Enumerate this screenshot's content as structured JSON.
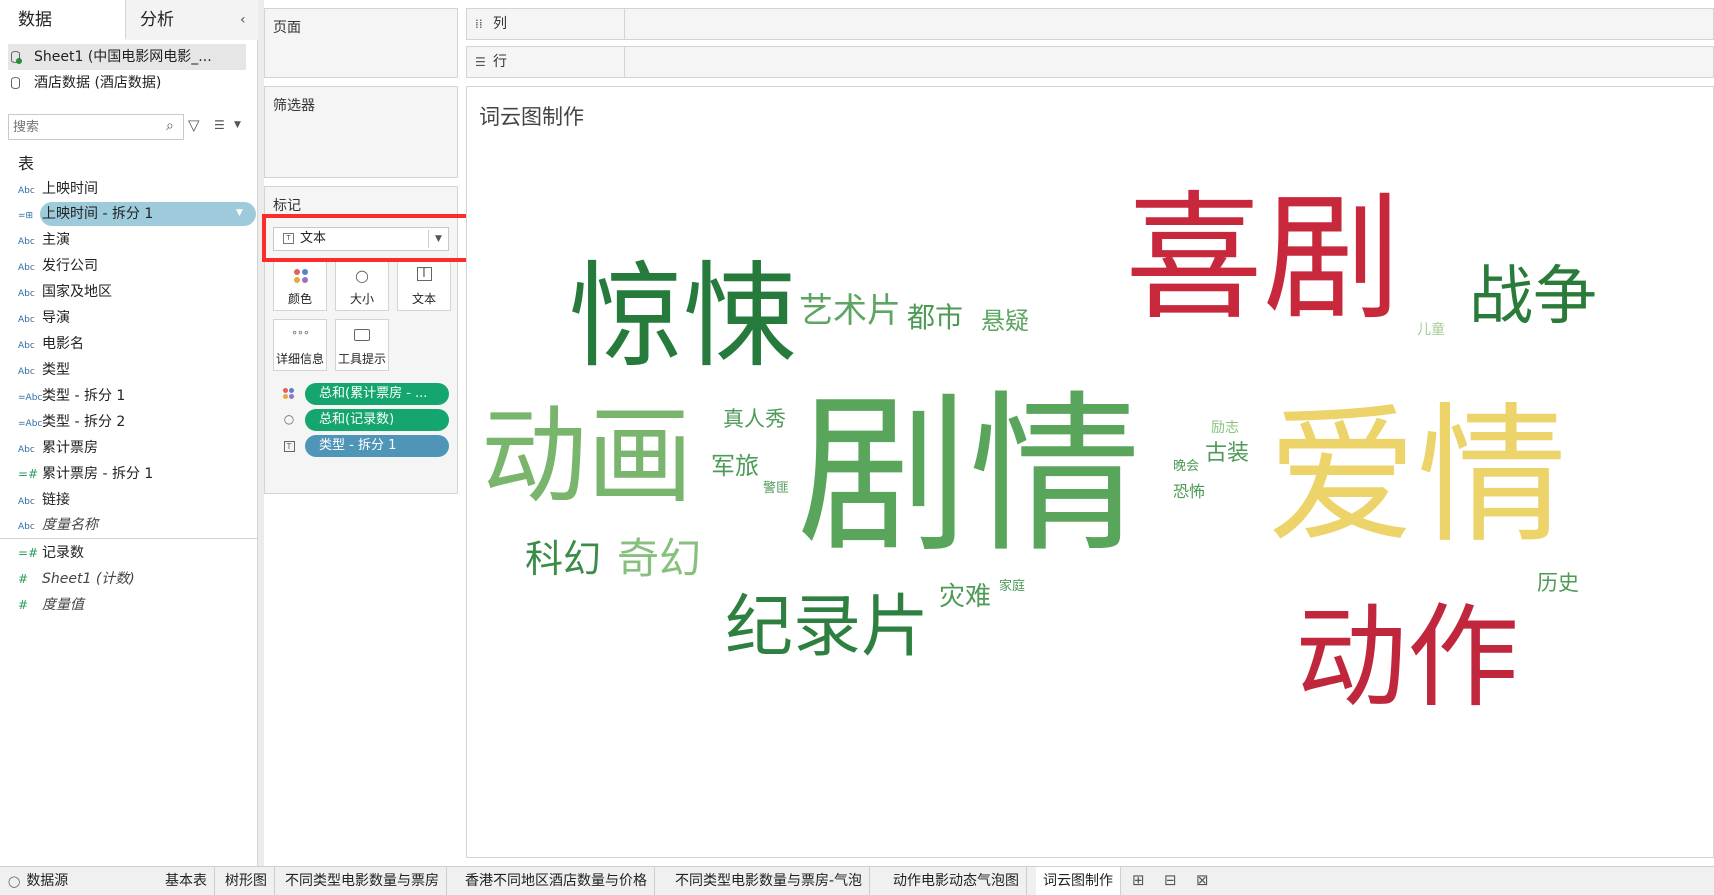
{
  "data_pane": {
    "tab_data": "数据",
    "tab_analysis": "分析",
    "collapse_icon": "chevron-left-icon",
    "sources": [
      {
        "label": "Sheet1 (中国电影网电影_..."
      },
      {
        "label": "酒店数据 (酒店数据)"
      }
    ],
    "search_placeholder": "搜索",
    "table_heading": "表",
    "fields": [
      {
        "type": "Abc",
        "label": "上映时间"
      },
      {
        "type": "=⊞",
        "label": "上映时间 - 拆分 1"
      },
      {
        "type": "Abc",
        "label": "主演"
      },
      {
        "type": "Abc",
        "label": "发行公司"
      },
      {
        "type": "Abc",
        "label": "国家及地区"
      },
      {
        "type": "Abc",
        "label": "导演"
      },
      {
        "type": "Abc",
        "label": "电影名"
      },
      {
        "type": "Abc",
        "label": "类型"
      },
      {
        "type": "=Abc",
        "label": "类型 - 拆分 1"
      },
      {
        "type": "=Abc",
        "label": "类型 - 拆分 2"
      },
      {
        "type": "Abc",
        "label": "累计票房"
      },
      {
        "type": "=#",
        "label": "累计票房 - 拆分 1"
      },
      {
        "type": "Abc",
        "label": "链接"
      },
      {
        "type": "Abc",
        "label": "度量名称"
      }
    ],
    "measures": [
      {
        "type": "=#",
        "label": "记录数"
      },
      {
        "type": "#",
        "label": "Sheet1 (计数)"
      },
      {
        "type": "#",
        "label": "度量值"
      }
    ]
  },
  "cards": {
    "pages_title": "页面",
    "filters_title": "筛选器",
    "marks_title": "标记",
    "mark_type": "文本",
    "mark_buttons": {
      "color": "颜色",
      "size": "大小",
      "text": "文本",
      "detail": "详细信息",
      "tooltip": "工具提示"
    },
    "pills": {
      "color": "总和(累计票房 - ...",
      "size": "总和(记录数)",
      "text": "类型 - 拆分 1"
    }
  },
  "shelves": {
    "columns": "列",
    "rows": "行"
  },
  "view": {
    "title": "词云图制作",
    "words": [
      {
        "text": "剧情",
        "size": 172,
        "color": "#5aa55c"
      },
      {
        "text": "爱情",
        "size": 150,
        "color": "#edd46a"
      },
      {
        "text": "喜剧",
        "size": 138,
        "color": "#c8283c"
      },
      {
        "text": "惊悚",
        "size": 114,
        "color": "#257a3c"
      },
      {
        "text": "动画",
        "size": 106,
        "color": "#79b56c"
      },
      {
        "text": "动作",
        "size": 112,
        "color": "#c0263c"
      },
      {
        "text": "纪录片",
        "size": 68,
        "color": "#2e8040"
      },
      {
        "text": "战争",
        "size": 64,
        "color": "#2a7a3a"
      },
      {
        "text": "艺术片",
        "size": 34,
        "color": "#5da562"
      },
      {
        "text": "都市",
        "size": 28,
        "color": "#4c9a54"
      },
      {
        "text": "悬疑",
        "size": 24,
        "color": "#5da562"
      },
      {
        "text": "科幻",
        "size": 38,
        "color": "#3b8c48"
      },
      {
        "text": "奇幻",
        "size": 42,
        "color": "#86c07c"
      },
      {
        "text": "真人秀",
        "size": 21,
        "color": "#4e9a57"
      },
      {
        "text": "军旅",
        "size": 24,
        "color": "#4e9a57"
      },
      {
        "text": "警匪",
        "size": 13,
        "color": "#4e9a57"
      },
      {
        "text": "灾难",
        "size": 26,
        "color": "#4e9a57"
      },
      {
        "text": "家庭",
        "size": 13,
        "color": "#4e9a57"
      },
      {
        "text": "古装",
        "size": 22,
        "color": "#4e9a57"
      },
      {
        "text": "晚会",
        "size": 13,
        "color": "#4e9a57"
      },
      {
        "text": "恐怖",
        "size": 16,
        "color": "#4e9a57"
      },
      {
        "text": "励志",
        "size": 14,
        "color": "#8cc27e"
      },
      {
        "text": "儿童",
        "size": 14,
        "color": "#a6cf96"
      },
      {
        "text": "历史",
        "size": 21,
        "color": "#4e9a57"
      }
    ]
  },
  "tabs": {
    "datasource": "数据源",
    "sheets": [
      {
        "label": "基本表"
      },
      {
        "label": "树形图"
      },
      {
        "label": "不同类型电影数量与票房"
      },
      {
        "label": "香港不同地区酒店数量与价格"
      },
      {
        "label": "不同类型电影数量与票房-气泡"
      },
      {
        "label": "动作电影动态气泡图"
      },
      {
        "label": "词云图制作"
      }
    ],
    "active": 6
  },
  "colors": {
    "highlight_red": "#ff2b2b",
    "pill_green": "#14a66e",
    "pill_blue": "#4f95b8",
    "field_highlight": "#9ecbdc"
  }
}
